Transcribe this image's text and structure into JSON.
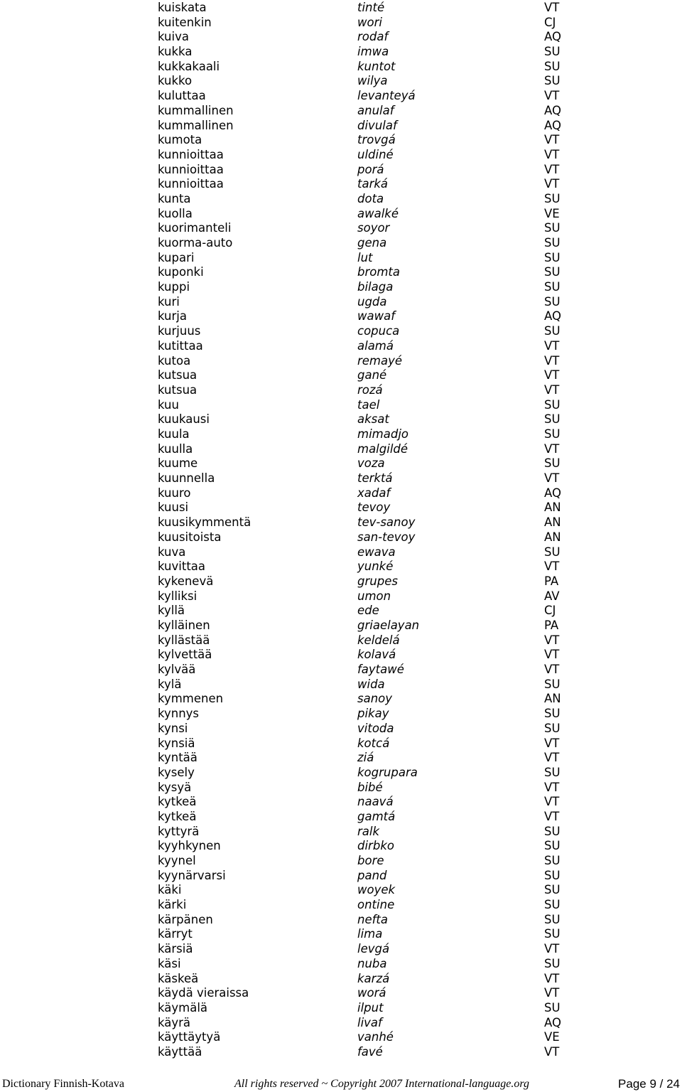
{
  "entries": [
    [
      "kuiskata",
      "tinté",
      "VT"
    ],
    [
      "kuitenkin",
      "wori",
      "CJ"
    ],
    [
      "kuiva",
      "rodaf",
      "AQ"
    ],
    [
      "kukka",
      "imwa",
      "SU"
    ],
    [
      "kukkakaali",
      "kuntot",
      "SU"
    ],
    [
      "kukko",
      "wilya",
      "SU"
    ],
    [
      "kuluttaa",
      "levanteyá",
      "VT"
    ],
    [
      "kummallinen",
      "anulaf",
      "AQ"
    ],
    [
      "kummallinen",
      "divulaf",
      "AQ"
    ],
    [
      "kumota",
      "trovgá",
      "VT"
    ],
    [
      "kunnioittaa",
      "uldiné",
      "VT"
    ],
    [
      "kunnioittaa",
      "porá",
      "VT"
    ],
    [
      "kunnioittaa",
      "tarká",
      "VT"
    ],
    [
      "kunta",
      "dota",
      "SU"
    ],
    [
      "kuolla",
      "awalké",
      "VE"
    ],
    [
      "kuorimanteli",
      "soyor",
      "SU"
    ],
    [
      "kuorma-auto",
      "gena",
      "SU"
    ],
    [
      "kupari",
      "lut",
      "SU"
    ],
    [
      "kuponki",
      "bromta",
      "SU"
    ],
    [
      "kuppi",
      "bilaga",
      "SU"
    ],
    [
      "kuri",
      "ugda",
      "SU"
    ],
    [
      "kurja",
      "wawaf",
      "AQ"
    ],
    [
      "kurjuus",
      "copuca",
      "SU"
    ],
    [
      "kutittaa",
      "alamá",
      "VT"
    ],
    [
      "kutoa",
      "remayé",
      "VT"
    ],
    [
      "kutsua",
      "gané",
      "VT"
    ],
    [
      "kutsua",
      "rozá",
      "VT"
    ],
    [
      "kuu",
      "tael",
      "SU"
    ],
    [
      "kuukausi",
      "aksat",
      "SU"
    ],
    [
      "kuula",
      "mimadjo",
      "SU"
    ],
    [
      "kuulla",
      "malgildé",
      "VT"
    ],
    [
      "kuume",
      "voza",
      "SU"
    ],
    [
      "kuunnella",
      "terktá",
      "VT"
    ],
    [
      "kuuro",
      "xadaf",
      "AQ"
    ],
    [
      "kuusi",
      "tevoy",
      "AN"
    ],
    [
      "kuusikymmentä",
      "tev-sanoy",
      "AN"
    ],
    [
      "kuusitoista",
      "san-tevoy",
      "AN"
    ],
    [
      "kuva",
      "ewava",
      "SU"
    ],
    [
      "kuvittaa",
      "yunké",
      "VT"
    ],
    [
      "kykenevä",
      "grupes",
      "PA"
    ],
    [
      "kylliksi",
      "umon",
      "AV"
    ],
    [
      "kyllä",
      "ede",
      "CJ"
    ],
    [
      "kylläinen",
      "griaelayan",
      "PA"
    ],
    [
      "kyllästää",
      "keldelá",
      "VT"
    ],
    [
      "kylvettää",
      "kolavá",
      "VT"
    ],
    [
      "kylvää",
      "faytawé",
      "VT"
    ],
    [
      "kylä",
      "wida",
      "SU"
    ],
    [
      "kymmenen",
      "sanoy",
      "AN"
    ],
    [
      "kynnys",
      "pikay",
      "SU"
    ],
    [
      "kynsi",
      "vitoda",
      "SU"
    ],
    [
      "kynsiä",
      "kotcá",
      "VT"
    ],
    [
      "kyntää",
      "ziá",
      "VT"
    ],
    [
      "kysely",
      "kogrupara",
      "SU"
    ],
    [
      "kysyä",
      "bibé",
      "VT"
    ],
    [
      "kytkeä",
      "naavá",
      "VT"
    ],
    [
      "kytkeä",
      "gamtá",
      "VT"
    ],
    [
      "kyttyrä",
      "ralk",
      "SU"
    ],
    [
      "kyyhkynen",
      "dirbko",
      "SU"
    ],
    [
      "kyynel",
      "bore",
      "SU"
    ],
    [
      "kyynärvarsi",
      "pand",
      "SU"
    ],
    [
      "käki",
      "woyek",
      "SU"
    ],
    [
      "kärki",
      "ontine",
      "SU"
    ],
    [
      "kärpänen",
      "nefta",
      "SU"
    ],
    [
      "kärryt",
      "lima",
      "SU"
    ],
    [
      "kärsiä",
      "levgá",
      "VT"
    ],
    [
      "käsi",
      "nuba",
      "SU"
    ],
    [
      "käskeä",
      "karzá",
      "VT"
    ],
    [
      "käydä vieraissa",
      "worá",
      "VT"
    ],
    [
      "käymälä",
      "ilput",
      "SU"
    ],
    [
      "käyrä",
      "livaf",
      "AQ"
    ],
    [
      "käyttäytyä",
      "vanhé",
      "VE"
    ],
    [
      "käyttää",
      "favé",
      "VT"
    ]
  ],
  "footer": {
    "left": "Dictionary Finnish-Kotava",
    "center": "All rights reserved ~ Copyright 2007 International-language.org",
    "right": "Page 9 / 24"
  }
}
